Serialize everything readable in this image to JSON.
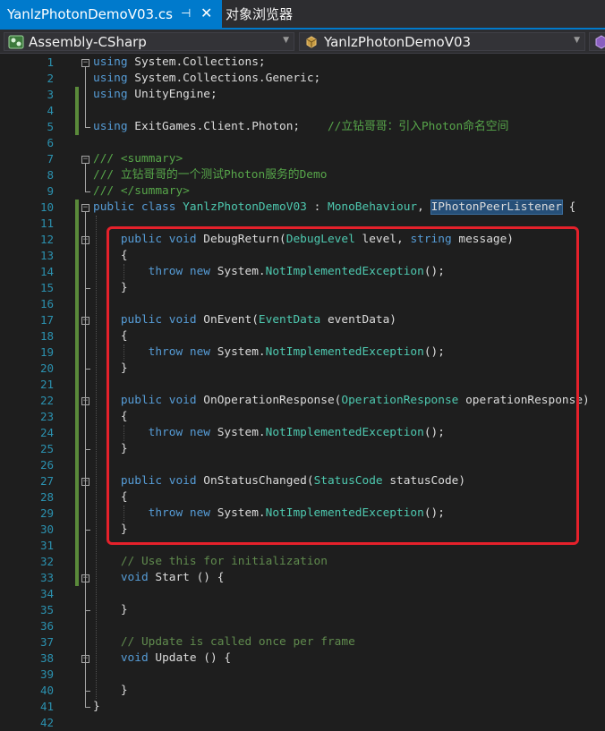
{
  "tabs": [
    {
      "label": "YanlzPhotonDemoV03.cs",
      "pin_icon": "pin-icon",
      "close_icon": "close-icon"
    },
    {
      "label": "对象浏览器"
    }
  ],
  "navbar": {
    "project": "Assembly-CSharp",
    "class": "YanlzPhotonDemoV03"
  },
  "colors": {
    "accent": "#007acc",
    "keyword": "#569cd6",
    "type": "#4ec9b0",
    "comment": "#57a64a",
    "line_number": "#2b91af",
    "highlight_box": "#e5212b"
  },
  "code_lines": [
    {
      "n": "1",
      "segs": [
        [
          "kw",
          "using"
        ],
        [
          "tx",
          " System.Collections;"
        ]
      ]
    },
    {
      "n": "2",
      "segs": [
        [
          "kw",
          "using"
        ],
        [
          "tx",
          " System.Collections.Generic;"
        ]
      ]
    },
    {
      "n": "3",
      "segs": [
        [
          "kw",
          "using"
        ],
        [
          "tx",
          " UnityEngine;"
        ]
      ]
    },
    {
      "n": "4",
      "segs": []
    },
    {
      "n": "5",
      "segs": [
        [
          "kw",
          "using"
        ],
        [
          "tx",
          " ExitGames.Client.Photon;    "
        ],
        [
          "cm",
          "//立钻哥哥：引入Photon命名空间"
        ]
      ]
    },
    {
      "n": "6",
      "segs": []
    },
    {
      "n": "7",
      "segs": [
        [
          "cm",
          "/// <summary>"
        ]
      ]
    },
    {
      "n": "8",
      "segs": [
        [
          "cm",
          "/// 立钻哥哥的一个测试Photon服务的Demo"
        ]
      ]
    },
    {
      "n": "9",
      "segs": [
        [
          "cm",
          "/// </summary>"
        ]
      ]
    },
    {
      "n": "10",
      "segs": [
        [
          "kw",
          "public class "
        ],
        [
          "tp",
          "YanlzPhotonDemoV03"
        ],
        [
          "tx",
          " : "
        ],
        [
          "tp",
          "MonoBehaviour"
        ],
        [
          "tx",
          ", "
        ],
        [
          "sel",
          "IPhotonPeerListener"
        ],
        [
          "tx",
          " {"
        ]
      ]
    },
    {
      "n": "11",
      "segs": []
    },
    {
      "n": "12",
      "segs": [
        [
          "tx",
          "    "
        ],
        [
          "kw",
          "public void"
        ],
        [
          "tx",
          " DebugReturn("
        ],
        [
          "tp",
          "DebugLevel"
        ],
        [
          "tx",
          " level, "
        ],
        [
          "kw",
          "string"
        ],
        [
          "tx",
          " message)"
        ]
      ]
    },
    {
      "n": "13",
      "segs": [
        [
          "tx",
          "    {"
        ]
      ]
    },
    {
      "n": "14",
      "segs": [
        [
          "tx",
          "        "
        ],
        [
          "kw",
          "throw new"
        ],
        [
          "tx",
          " System."
        ],
        [
          "tp",
          "NotImplementedException"
        ],
        [
          "tx",
          "();"
        ]
      ]
    },
    {
      "n": "15",
      "segs": [
        [
          "tx",
          "    }"
        ]
      ]
    },
    {
      "n": "16",
      "segs": []
    },
    {
      "n": "17",
      "segs": [
        [
          "tx",
          "    "
        ],
        [
          "kw",
          "public void"
        ],
        [
          "tx",
          " OnEvent("
        ],
        [
          "tp",
          "EventData"
        ],
        [
          "tx",
          " eventData)"
        ]
      ]
    },
    {
      "n": "18",
      "segs": [
        [
          "tx",
          "    {"
        ]
      ]
    },
    {
      "n": "19",
      "segs": [
        [
          "tx",
          "        "
        ],
        [
          "kw",
          "throw new"
        ],
        [
          "tx",
          " System."
        ],
        [
          "tp",
          "NotImplementedException"
        ],
        [
          "tx",
          "();"
        ]
      ]
    },
    {
      "n": "20",
      "segs": [
        [
          "tx",
          "    }"
        ]
      ]
    },
    {
      "n": "21",
      "segs": []
    },
    {
      "n": "22",
      "segs": [
        [
          "tx",
          "    "
        ],
        [
          "kw",
          "public void"
        ],
        [
          "tx",
          " OnOperationResponse("
        ],
        [
          "tp",
          "OperationResponse"
        ],
        [
          "tx",
          " operationResponse)"
        ]
      ]
    },
    {
      "n": "23",
      "segs": [
        [
          "tx",
          "    {"
        ]
      ]
    },
    {
      "n": "24",
      "segs": [
        [
          "tx",
          "        "
        ],
        [
          "kw",
          "throw new"
        ],
        [
          "tx",
          " System."
        ],
        [
          "tp",
          "NotImplementedException"
        ],
        [
          "tx",
          "();"
        ]
      ]
    },
    {
      "n": "25",
      "segs": [
        [
          "tx",
          "    }"
        ]
      ]
    },
    {
      "n": "26",
      "segs": []
    },
    {
      "n": "27",
      "segs": [
        [
          "tx",
          "    "
        ],
        [
          "kw",
          "public void"
        ],
        [
          "tx",
          " OnStatusChanged("
        ],
        [
          "tp",
          "StatusCode"
        ],
        [
          "tx",
          " statusCode)"
        ]
      ]
    },
    {
      "n": "28",
      "segs": [
        [
          "tx",
          "    {"
        ]
      ]
    },
    {
      "n": "29",
      "segs": [
        [
          "tx",
          "        "
        ],
        [
          "kw",
          "throw new"
        ],
        [
          "tx",
          " System."
        ],
        [
          "tp",
          "NotImplementedException"
        ],
        [
          "tx",
          "();"
        ]
      ]
    },
    {
      "n": "30",
      "segs": [
        [
          "tx",
          "    }"
        ]
      ]
    },
    {
      "n": "31",
      "segs": []
    },
    {
      "n": "32",
      "segs": [
        [
          "tx",
          "    "
        ],
        [
          "cmx",
          "// Use this for initialization"
        ]
      ]
    },
    {
      "n": "33",
      "segs": [
        [
          "tx",
          "    "
        ],
        [
          "kw",
          "void"
        ],
        [
          "tx",
          " Start () {"
        ]
      ]
    },
    {
      "n": "34",
      "segs": []
    },
    {
      "n": "35",
      "segs": [
        [
          "tx",
          "    }"
        ]
      ]
    },
    {
      "n": "36",
      "segs": []
    },
    {
      "n": "37",
      "segs": [
        [
          "tx",
          "    "
        ],
        [
          "cmx",
          "// Update is called once per frame"
        ]
      ]
    },
    {
      "n": "38",
      "segs": [
        [
          "tx",
          "    "
        ],
        [
          "kw",
          "void"
        ],
        [
          "tx",
          " Update () {"
        ]
      ]
    },
    {
      "n": "39",
      "segs": []
    },
    {
      "n": "40",
      "segs": [
        [
          "tx",
          "    }"
        ]
      ]
    },
    {
      "n": "41",
      "segs": [
        [
          "tx",
          "}"
        ]
      ]
    },
    {
      "n": "42",
      "segs": []
    }
  ]
}
